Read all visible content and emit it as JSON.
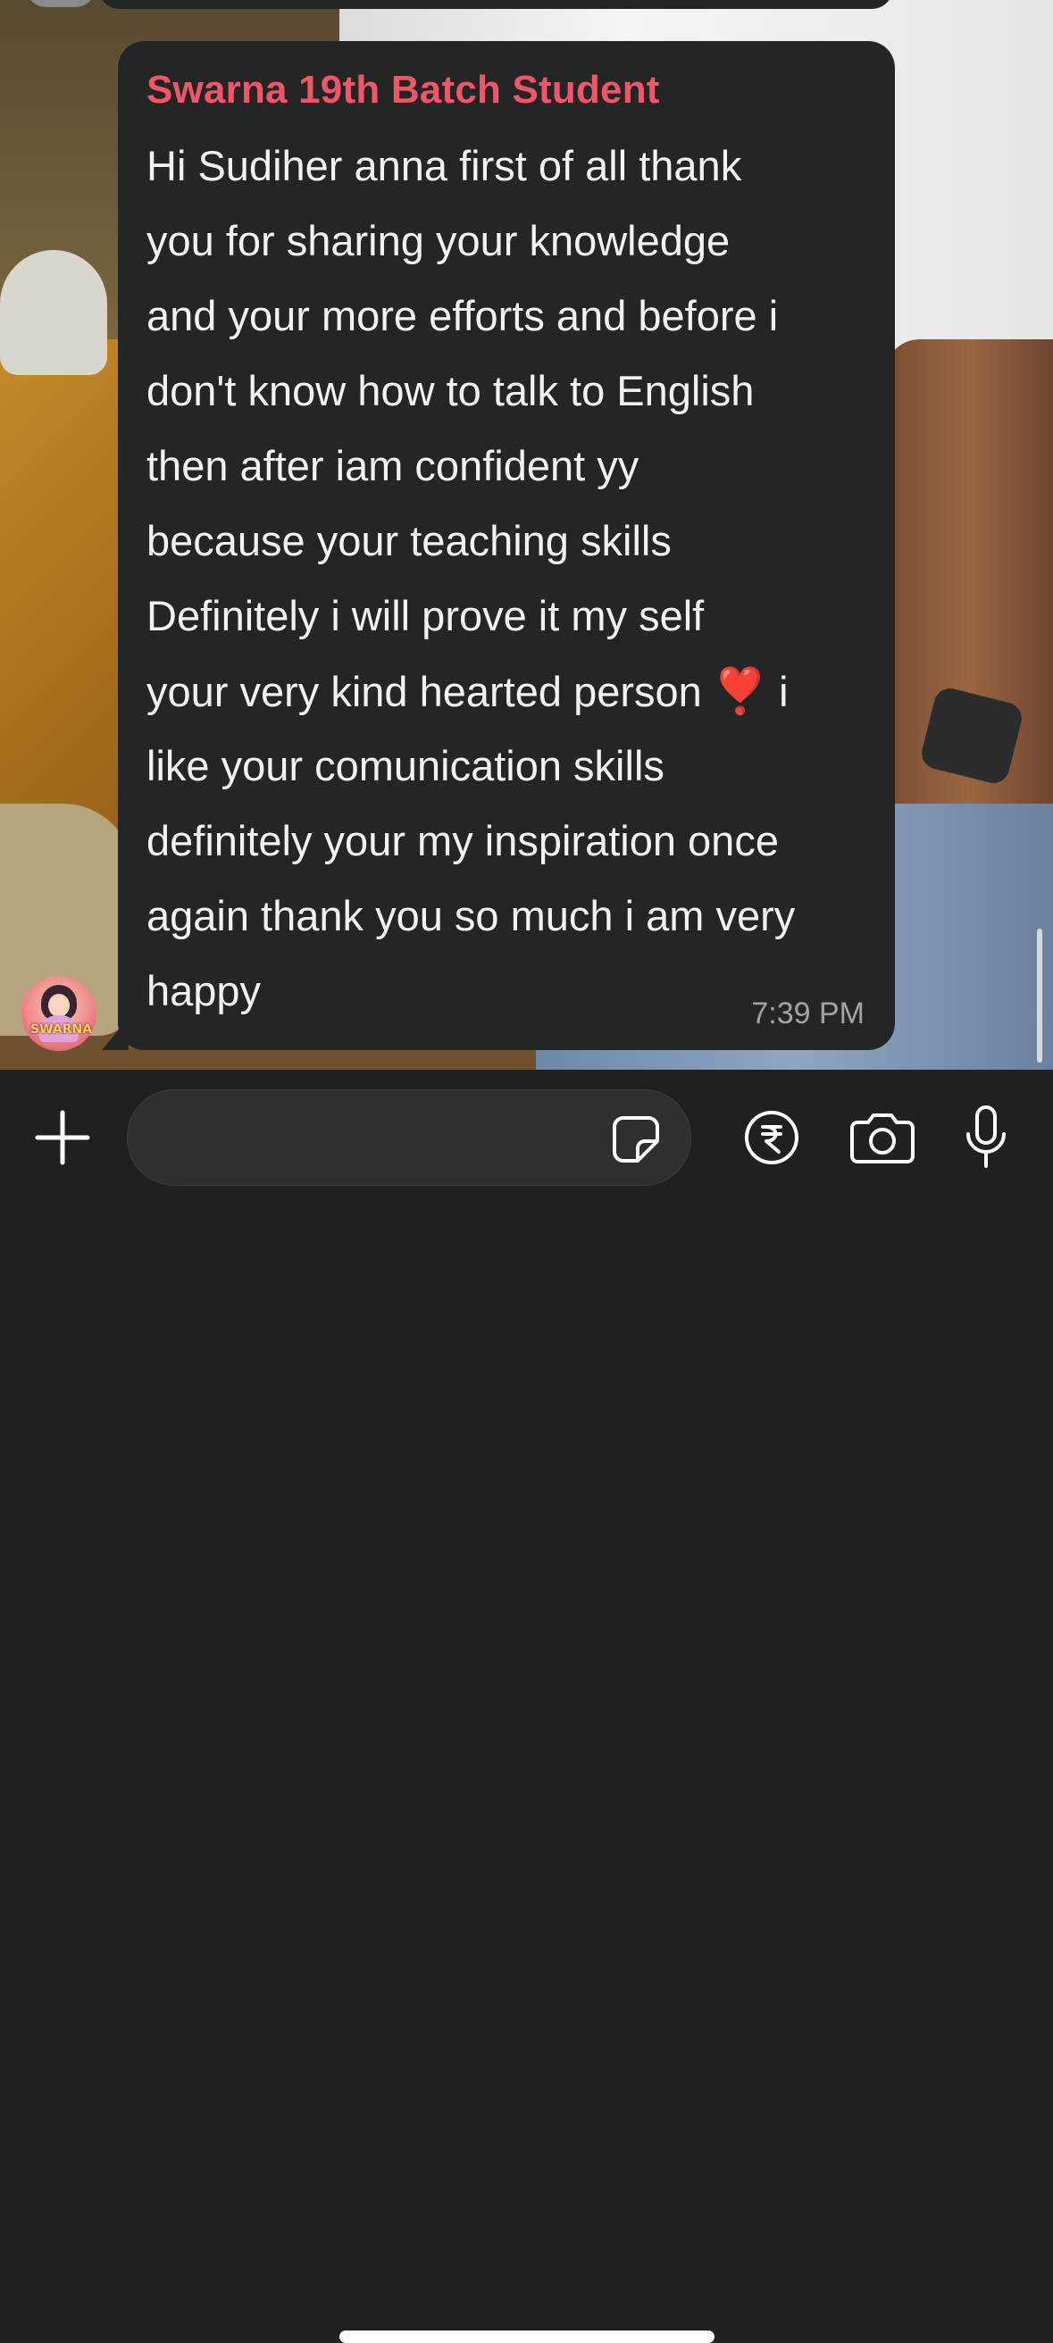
{
  "message": {
    "sender": "Swarna 19th Batch Student",
    "lines": [
      "Hi Sudiher anna first of all thank",
      "you for sharing your knowledge",
      "and your more efforts and before i",
      "don't know how to talk to English",
      "then after iam confident yy",
      "because your teaching skills",
      "Definitely i will prove it my self",
      "your very kind hearted person",
      "like your comunication skills",
      "definitely your my inspiration once",
      "again thank you so much i am very",
      "happy"
    ],
    "heart": "❣️",
    "line8_suffix": "i",
    "time": "7:39 PM",
    "avatar_label": "SWARNA"
  },
  "composer": {
    "placeholder": "",
    "icons": [
      "plus-icon",
      "sticker-icon",
      "rupee-icon",
      "camera-icon",
      "mic-icon"
    ]
  },
  "colors": {
    "sender_name": "#f2546a",
    "bubble": "#242626",
    "background": "#1f2020",
    "heart": "#e51c2c"
  }
}
